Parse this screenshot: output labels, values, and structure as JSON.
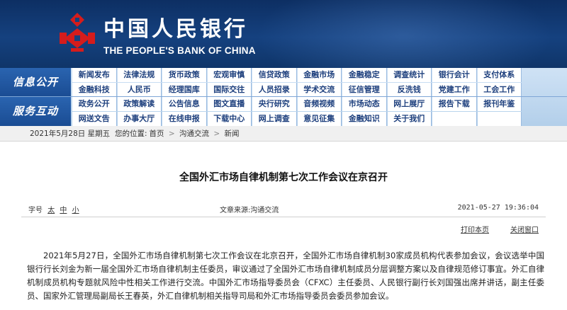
{
  "header": {
    "bank_name_cn": "中国人民银行",
    "bank_name_en": "THE PEOPLE'S BANK OF CHINA",
    "logo_icon": "pboc-emblem-icon",
    "colors": {
      "header_bg": "#15417f",
      "logo_red": "#d51c1c",
      "nav_blue": "#1a4c93"
    }
  },
  "nav": {
    "groups": [
      {
        "label": "信息公开",
        "rows": [
          [
            "新闻发布",
            "法律法规",
            "货币政策",
            "宏观审慎",
            "信贷政策",
            "金融市场",
            "金融稳定",
            "调查统计",
            "银行会计",
            "支付体系"
          ],
          [
            "金融科技",
            "人民币",
            "经理国库",
            "国际交往",
            "人员招录",
            "学术交流",
            "征信管理",
            "反洗钱",
            "党建工作",
            "工会工作"
          ]
        ]
      },
      {
        "label": "服务互动",
        "rows": [
          [
            "政务公开",
            "政策解读",
            "公告信息",
            "图文直播",
            "央行研究",
            "音频视频",
            "市场动态",
            "网上展厅",
            "报告下载",
            "报刊年鉴"
          ],
          [
            "网送文告",
            "办事大厅",
            "在线申报",
            "下载中心",
            "网上调查",
            "意见征集",
            "金融知识",
            "关于我们",
            "",
            ""
          ]
        ]
      }
    ]
  },
  "breadcrumb": {
    "date": "2021年5月28日 星期五",
    "separator": "|",
    "location_label": "您的位置:",
    "items": [
      "首页",
      "沟通交流",
      "新闻"
    ],
    "item_separator": ">"
  },
  "article": {
    "title": "全国外汇市场自律机制第七次工作会议在京召开",
    "font_size_label": "字号",
    "font_sizes": [
      "太",
      "中",
      "小"
    ],
    "source": "文章来源:沟通交流",
    "timestamp": "2021-05-27  19:36:04",
    "print_label": "打印本页",
    "close_label": "关闭窗口",
    "paragraph": "2021年5月27日，全国外汇市场自律机制第七次工作会议在北京召开，全国外汇市场自律机制30家成员机构代表参加会议，会议选举中国银行行长刘金为新一届全国外汇市场自律机制主任委员，审议通过了全国外汇市场自律机制成员分层调整方案以及自律规范修订事宜。外汇自律机制成员机构专题就风险中性相关工作进行交流。中国外汇市场指导委员会（CFXC）主任委员、人民银行副行长刘国强出席并讲话，副主任委员、国家外汇管理局副局长王春英，外汇自律机制相关指导司局和外汇市场指导委员会委员参加会议。"
  }
}
